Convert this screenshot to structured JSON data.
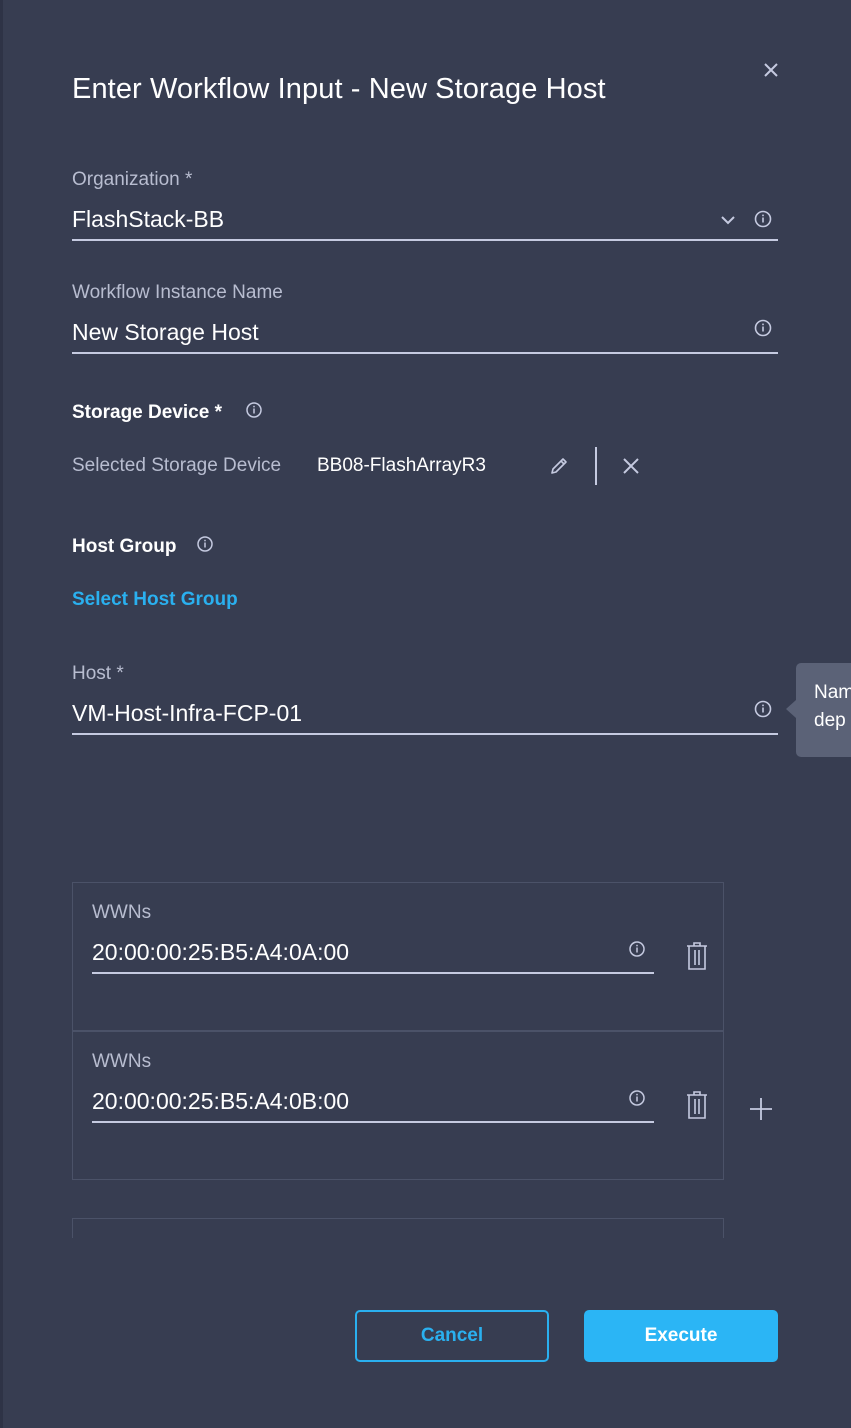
{
  "dialog": {
    "title": "Enter Workflow Input - New Storage Host"
  },
  "fields": {
    "organization": {
      "label": "Organization *",
      "value": "FlashStack-BB"
    },
    "workflow_instance_name": {
      "label": "Workflow Instance Name",
      "value": "New Storage Host"
    },
    "storage_device": {
      "title": "Storage Device *",
      "selected_label": "Selected Storage Device",
      "selected_value": "BB08-FlashArrayR3"
    },
    "host_group": {
      "title": "Host Group",
      "link_label": "Select Host Group"
    },
    "host": {
      "label": "Host *",
      "value": "VM-Host-Infra-FCP-01"
    }
  },
  "tooltip": {
    "text": "Nam\ndep"
  },
  "wwns": [
    {
      "label": "WWNs",
      "value": "20:00:00:25:B5:A4:0A:00"
    },
    {
      "label": "WWNs",
      "value": "20:00:00:25:B5:A4:0B:00"
    }
  ],
  "footer": {
    "cancel_label": "Cancel",
    "execute_label": "Execute"
  },
  "colors": {
    "background": "#373d51",
    "accent": "#2bb5f5",
    "link": "#2ab0ef",
    "tooltip_bg": "#5b6277"
  }
}
